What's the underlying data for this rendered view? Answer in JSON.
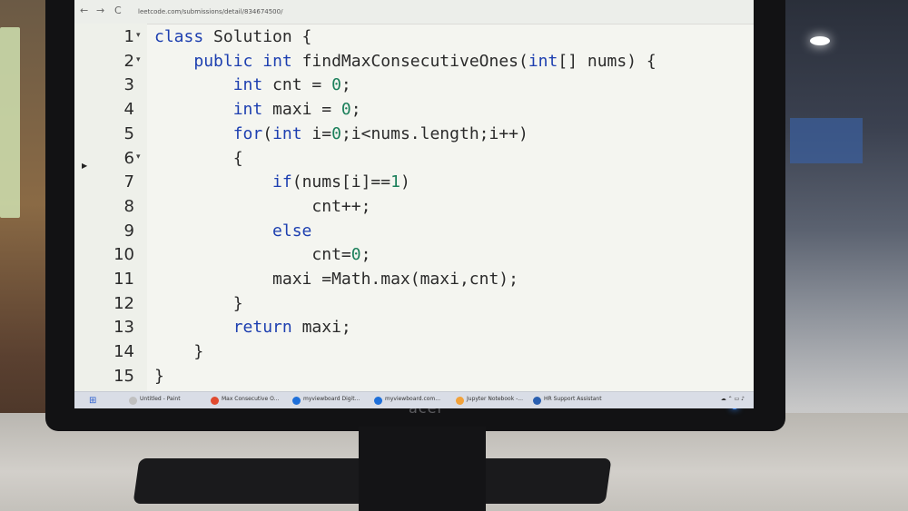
{
  "browser": {
    "url": "leetcode.com/submissions/detail/834674500/",
    "nav_back": "←",
    "nav_forward": "→",
    "nav_refresh": "C"
  },
  "editor": {
    "lines": [
      {
        "n": "1",
        "text": "class Solution {"
      },
      {
        "n": "2",
        "text": "    public int findMaxConsecutiveOnes(int[] nums) {"
      },
      {
        "n": "3",
        "text": "        int cnt = 0;"
      },
      {
        "n": "4",
        "text": "        int maxi = 0;"
      },
      {
        "n": "5",
        "text": "        for(int i=0;i<nums.length;i++)"
      },
      {
        "n": "6",
        "text": "        {"
      },
      {
        "n": "7",
        "text": "            if(nums[i]==1)"
      },
      {
        "n": "8",
        "text": "                cnt++;"
      },
      {
        "n": "9",
        "text": "            else"
      },
      {
        "n": "10",
        "text": "                cnt=0;"
      },
      {
        "n": "11",
        "text": "            maxi =Math.max(maxi,cnt);"
      },
      {
        "n": "12",
        "text": "        }"
      },
      {
        "n": "13",
        "text": "        return maxi;"
      },
      {
        "n": "14",
        "text": "    }"
      },
      {
        "n": "15",
        "text": "}"
      }
    ]
  },
  "taskbar": {
    "items": [
      {
        "label": "Untitled - Paint",
        "color": "#c0c0c0"
      },
      {
        "label": "Max Consecutive O...",
        "color": "#e04a2f"
      },
      {
        "label": "myviewboard Digit...",
        "color": "#1e6fd9"
      },
      {
        "label": "myviewboard.com...",
        "color": "#1e6fd9"
      },
      {
        "label": "Jupyter Notebook -...",
        "color": "#f2a23a"
      },
      {
        "label": "HR Support Assistant",
        "color": "#2a5fb0"
      }
    ]
  },
  "monitor": {
    "brand": "acer"
  }
}
